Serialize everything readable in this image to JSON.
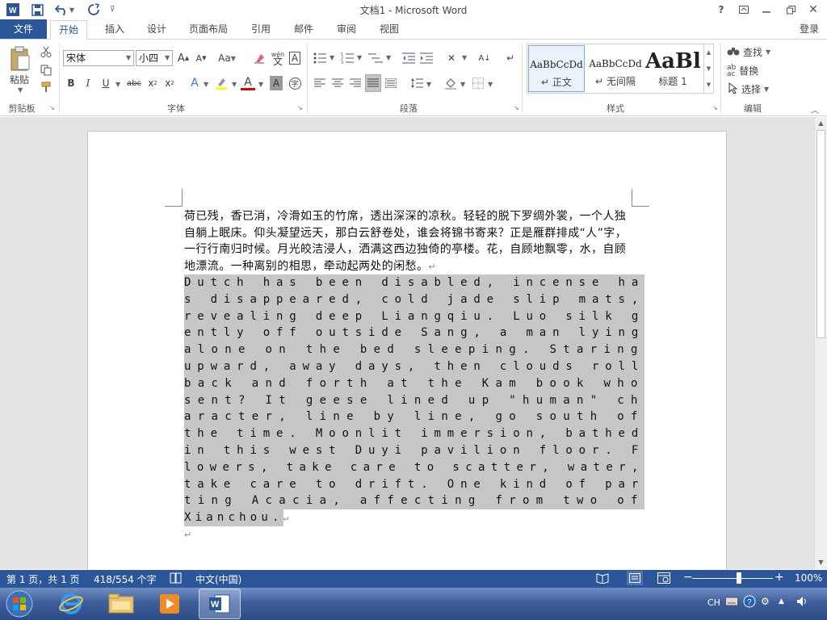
{
  "window": {
    "title": "文档1 - Microsoft Word",
    "login": "登录"
  },
  "tabs": [
    "文件",
    "开始",
    "插入",
    "设计",
    "页面布局",
    "引用",
    "邮件",
    "审阅",
    "视图"
  ],
  "ribbon": {
    "clipboard": {
      "paste_label": "粘贴",
      "group_label": "剪贴板"
    },
    "font": {
      "font_name": "宋体",
      "font_size": "小四",
      "group_label": "字体",
      "case_label": "Aa",
      "phonetic_glyph": "wén",
      "border_char": "A",
      "enclose_char": "字"
    },
    "paragraph": {
      "group_label": "段落"
    },
    "styles": {
      "group_label": "样式",
      "tiles": [
        {
          "sample": "AaBbCcDd",
          "name": "正文"
        },
        {
          "sample": "AaBbCcDd",
          "name": "无间隔"
        },
        {
          "sample": "AaBl",
          "name": "标题 1"
        }
      ]
    },
    "editing": {
      "find": "查找",
      "replace": "替换",
      "select": "选择",
      "group_label": "编辑"
    }
  },
  "document": {
    "para1": "荷已残，香已消，冷滑如玉的竹席，透出深深的凉秋。轻轻的脱下罗绸外裳，一个人独自躺上眠床。仰头凝望远天，那白云舒卷处，谁会将锦书寄来？正是雁群排成“人”字，一行行南归时候。月光皎洁浸人，洒满这西边独倚的亭楼。花，自顾地飘零，水，自顾地漂流。一种离别的相思，牵动起两处的闲愁。",
    "para2_lines": [
      "Dutch has been disabled, incense ha",
      "s disappeared, cold jade slip mats,",
      "revealing deep Liangqiu. Luo silk g",
      "ently off outside Sang, a man lying",
      "alone on the bed sleeping. Staring",
      "upward, away days, then clouds roll",
      "back and forth at the Kam book who",
      "sent? It geese lined up \"human\" ch",
      "aracter, line by line, go south of",
      "the time. Moonlit immersion, bathed",
      "in this west Duyi pavilion floor. F",
      "lowers, take care to scatter, water,",
      "take care to drift. One kind of par",
      "ting Acacia, affecting from two of",
      "Xianchou."
    ],
    "para_mark": "↵"
  },
  "status": {
    "page": "第 1 页，共 1 页",
    "words": "418/554 个字",
    "language": "中文(中国)",
    "zoom": "100%",
    "zoom_value": 100
  },
  "taskbar": {
    "ime": "CH"
  },
  "colors": {
    "accent": "#2b579a",
    "selection": "#c6c6c6"
  }
}
